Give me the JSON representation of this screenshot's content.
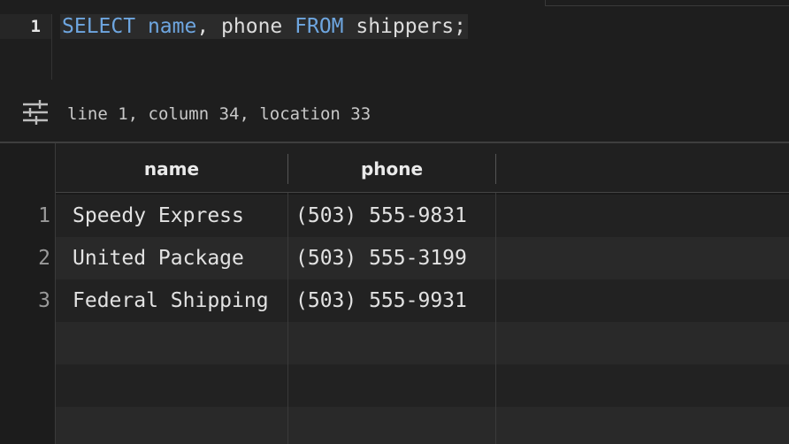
{
  "editor": {
    "line_number": "1",
    "tokens": {
      "select_kw": "SELECT",
      "col1": "name",
      "comma_phone": ", phone ",
      "from_kw": "FROM",
      "table_semicolon": " shippers;"
    },
    "status": "line 1, column 34, location 33"
  },
  "results": {
    "columns": [
      "name",
      "phone"
    ],
    "rows": [
      {
        "num": "1",
        "name": "Speedy Express",
        "phone": "(503) 555-9831"
      },
      {
        "num": "2",
        "name": "United Package",
        "phone": "(503) 555-3199"
      },
      {
        "num": "3",
        "name": "Federal Shipping",
        "phone": "(503) 555-9931"
      }
    ]
  },
  "icons": {
    "format": "sliders-icon"
  }
}
